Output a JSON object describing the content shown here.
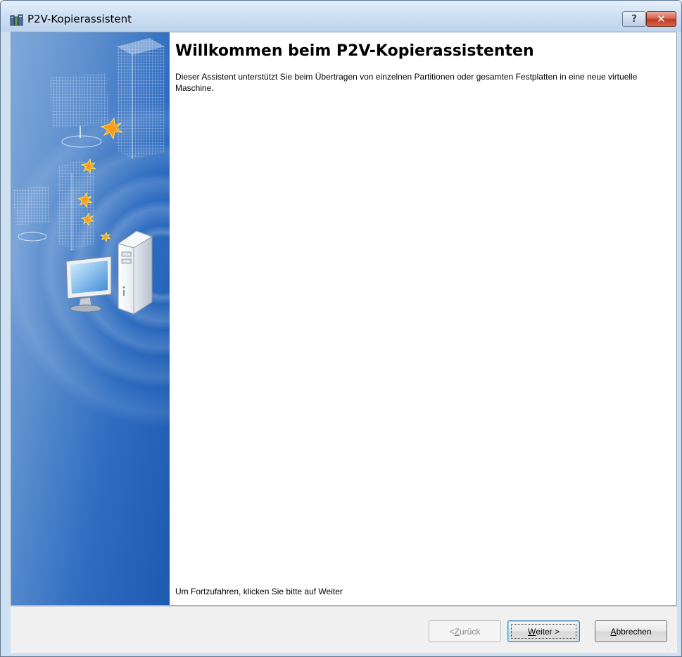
{
  "window": {
    "title": "P2V-Kopierassistent",
    "help_button_label": "?",
    "close_button_label": "✕"
  },
  "content": {
    "heading": "Willkommen beim P2V-Kopierassistenten",
    "intro": "Dieser Assistent unterstützt Sie beim Übertragen von einzelnen Partitionen oder gesamten Festplatten in eine neue virtuelle Maschine.",
    "continue_hint": "Um Fortzufahren, klicken Sie bitte auf Weiter"
  },
  "buttons": {
    "back": {
      "label": "< Zurück",
      "prefix": "< ",
      "mnemonic": "Z",
      "rest": "urück",
      "enabled": false
    },
    "next": {
      "label": "Weiter >",
      "mnemonic": "W",
      "rest": "eiter >"
    },
    "cancel": {
      "label": "Abbrechen",
      "mnemonic": "A",
      "rest": "bbrechen"
    }
  },
  "icons": {
    "app": "p2v-app-icon",
    "banner": "servers-to-virtual-machine-illustration"
  },
  "colors": {
    "title_bar": "#cfe0f2",
    "side_panel": "#2f6dc1",
    "close_button": "#c0391f"
  }
}
